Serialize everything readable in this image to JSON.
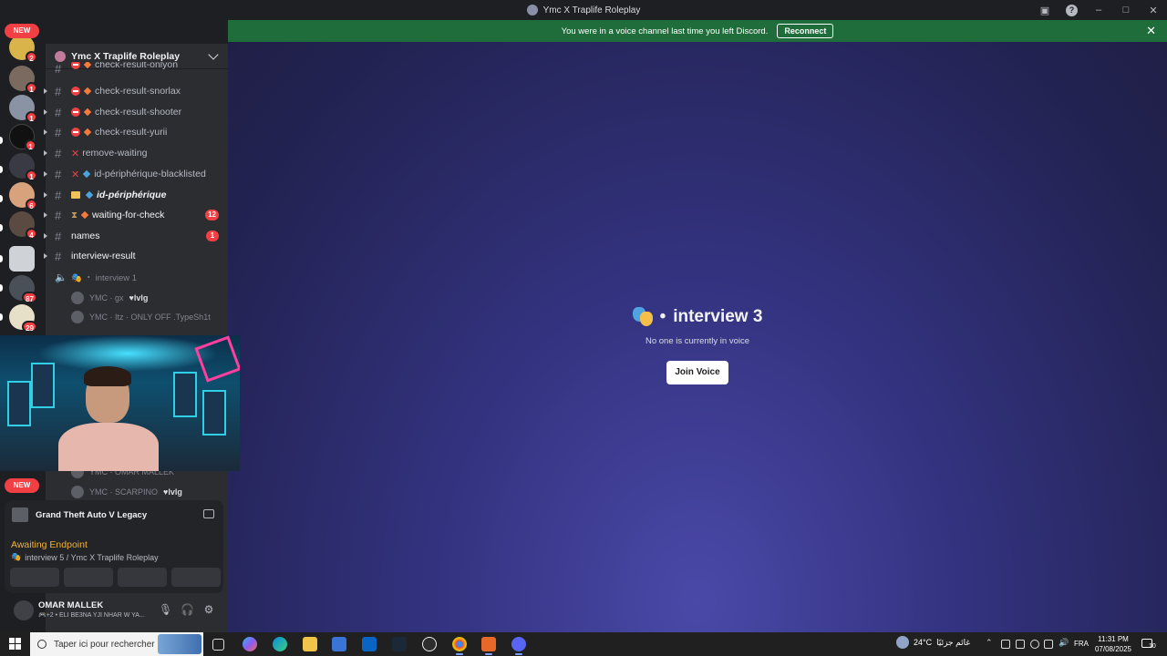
{
  "window": {
    "title": "Ymc X Traplife Roleplay"
  },
  "banner": {
    "text": "You were in a voice channel last time you left Discord.",
    "button": "Reconnect",
    "close": "✕"
  },
  "rail": {
    "new_top": "NEW",
    "new_bottom": "NEW",
    "badges": [
      "2",
      "1",
      "1",
      "1",
      "1",
      "6",
      "4",
      "87",
      "29"
    ]
  },
  "server": {
    "name": "Ymc X Traplife Roleplay"
  },
  "channels": [
    {
      "name": "check-result-snorlax",
      "badge": ""
    },
    {
      "name": "check-result-shooter",
      "badge": ""
    },
    {
      "name": "check-result-yurii",
      "badge": ""
    },
    {
      "name": "remove-waiting",
      "badge": ""
    },
    {
      "name": "id-périphérique-blacklisted",
      "badge": ""
    },
    {
      "name": "id-périphérique",
      "badge": ""
    },
    {
      "name": "waiting-for-check",
      "badge": "12"
    },
    {
      "name": "names",
      "badge": "1"
    },
    {
      "name": "interview-result",
      "badge": ""
    }
  ],
  "partial_top_channel": "check-result-onlyon",
  "voice": {
    "channel": "interview 1",
    "separator": "・",
    "users": [
      {
        "name": "YMC · gx",
        "tag": "lvlg"
      },
      {
        "name": "YMC · Itz · ONLY OFF .TypeSh1t",
        "tag": ""
      },
      {
        "name": "YMC · OMAR MALLEK",
        "tag": ""
      },
      {
        "name": "YMC · SCARPINO",
        "tag": "lvlg"
      }
    ]
  },
  "activity": {
    "game": "Grand Theft Auto V Legacy",
    "status": "Awaiting Endpoint",
    "location": "interview 5 / Ymc X Traplife Roleplay"
  },
  "user": {
    "name": "OMAR MALLEK",
    "status": "🎮+2 • ELI BE3NA YJI NHAR W YA..."
  },
  "main": {
    "channel_title": "interview 3",
    "separator": "•",
    "subtitle": "No one is currently in voice",
    "join_label": "Join Voice"
  },
  "taskbar": {
    "search_placeholder": "Taper ici pour rechercher",
    "temperature": "24°C",
    "weather_text": "غائم جزئيًا",
    "language": "FRA",
    "time": "11:31 PM",
    "date": "07/08/2025",
    "notification_count": "10"
  },
  "colors": {
    "banner": "#1f6d3a",
    "badge": "#f23f43",
    "sidebar": "#2b2d31",
    "rail": "#1e1f22",
    "awaiting": "#f0b232"
  }
}
